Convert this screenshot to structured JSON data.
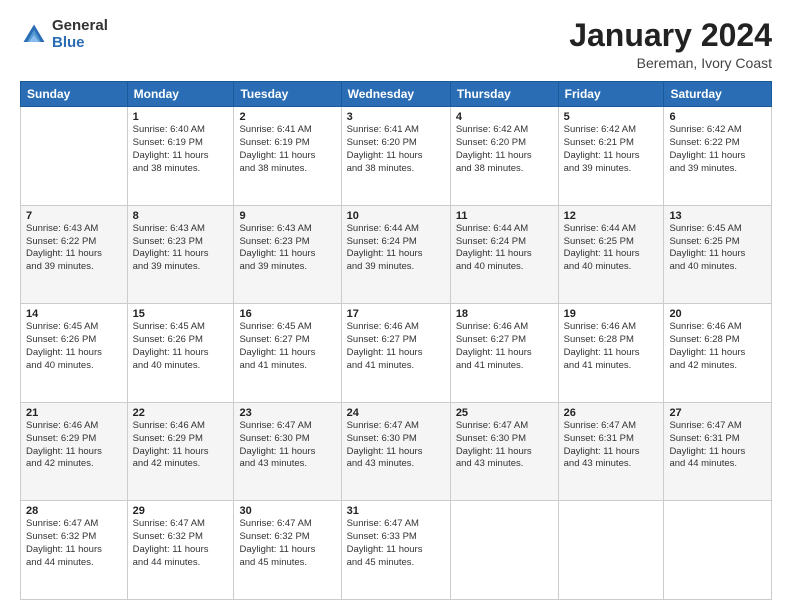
{
  "header": {
    "logo": {
      "general": "General",
      "blue": "Blue"
    },
    "title": "January 2024",
    "location": "Bereman, Ivory Coast"
  },
  "days_of_week": [
    "Sunday",
    "Monday",
    "Tuesday",
    "Wednesday",
    "Thursday",
    "Friday",
    "Saturday"
  ],
  "weeks": [
    [
      {
        "day": "",
        "sunrise": "",
        "sunset": "",
        "daylight": ""
      },
      {
        "day": "1",
        "sunrise": "Sunrise: 6:40 AM",
        "sunset": "Sunset: 6:19 PM",
        "daylight": "Daylight: 11 hours and 38 minutes."
      },
      {
        "day": "2",
        "sunrise": "Sunrise: 6:41 AM",
        "sunset": "Sunset: 6:19 PM",
        "daylight": "Daylight: 11 hours and 38 minutes."
      },
      {
        "day": "3",
        "sunrise": "Sunrise: 6:41 AM",
        "sunset": "Sunset: 6:20 PM",
        "daylight": "Daylight: 11 hours and 38 minutes."
      },
      {
        "day": "4",
        "sunrise": "Sunrise: 6:42 AM",
        "sunset": "Sunset: 6:20 PM",
        "daylight": "Daylight: 11 hours and 38 minutes."
      },
      {
        "day": "5",
        "sunrise": "Sunrise: 6:42 AM",
        "sunset": "Sunset: 6:21 PM",
        "daylight": "Daylight: 11 hours and 39 minutes."
      },
      {
        "day": "6",
        "sunrise": "Sunrise: 6:42 AM",
        "sunset": "Sunset: 6:22 PM",
        "daylight": "Daylight: 11 hours and 39 minutes."
      }
    ],
    [
      {
        "day": "7",
        "sunrise": "Sunrise: 6:43 AM",
        "sunset": "Sunset: 6:22 PM",
        "daylight": "Daylight: 11 hours and 39 minutes."
      },
      {
        "day": "8",
        "sunrise": "Sunrise: 6:43 AM",
        "sunset": "Sunset: 6:23 PM",
        "daylight": "Daylight: 11 hours and 39 minutes."
      },
      {
        "day": "9",
        "sunrise": "Sunrise: 6:43 AM",
        "sunset": "Sunset: 6:23 PM",
        "daylight": "Daylight: 11 hours and 39 minutes."
      },
      {
        "day": "10",
        "sunrise": "Sunrise: 6:44 AM",
        "sunset": "Sunset: 6:24 PM",
        "daylight": "Daylight: 11 hours and 39 minutes."
      },
      {
        "day": "11",
        "sunrise": "Sunrise: 6:44 AM",
        "sunset": "Sunset: 6:24 PM",
        "daylight": "Daylight: 11 hours and 40 minutes."
      },
      {
        "day": "12",
        "sunrise": "Sunrise: 6:44 AM",
        "sunset": "Sunset: 6:25 PM",
        "daylight": "Daylight: 11 hours and 40 minutes."
      },
      {
        "day": "13",
        "sunrise": "Sunrise: 6:45 AM",
        "sunset": "Sunset: 6:25 PM",
        "daylight": "Daylight: 11 hours and 40 minutes."
      }
    ],
    [
      {
        "day": "14",
        "sunrise": "Sunrise: 6:45 AM",
        "sunset": "Sunset: 6:26 PM",
        "daylight": "Daylight: 11 hours and 40 minutes."
      },
      {
        "day": "15",
        "sunrise": "Sunrise: 6:45 AM",
        "sunset": "Sunset: 6:26 PM",
        "daylight": "Daylight: 11 hours and 40 minutes."
      },
      {
        "day": "16",
        "sunrise": "Sunrise: 6:45 AM",
        "sunset": "Sunset: 6:27 PM",
        "daylight": "Daylight: 11 hours and 41 minutes."
      },
      {
        "day": "17",
        "sunrise": "Sunrise: 6:46 AM",
        "sunset": "Sunset: 6:27 PM",
        "daylight": "Daylight: 11 hours and 41 minutes."
      },
      {
        "day": "18",
        "sunrise": "Sunrise: 6:46 AM",
        "sunset": "Sunset: 6:27 PM",
        "daylight": "Daylight: 11 hours and 41 minutes."
      },
      {
        "day": "19",
        "sunrise": "Sunrise: 6:46 AM",
        "sunset": "Sunset: 6:28 PM",
        "daylight": "Daylight: 11 hours and 41 minutes."
      },
      {
        "day": "20",
        "sunrise": "Sunrise: 6:46 AM",
        "sunset": "Sunset: 6:28 PM",
        "daylight": "Daylight: 11 hours and 42 minutes."
      }
    ],
    [
      {
        "day": "21",
        "sunrise": "Sunrise: 6:46 AM",
        "sunset": "Sunset: 6:29 PM",
        "daylight": "Daylight: 11 hours and 42 minutes."
      },
      {
        "day": "22",
        "sunrise": "Sunrise: 6:46 AM",
        "sunset": "Sunset: 6:29 PM",
        "daylight": "Daylight: 11 hours and 42 minutes."
      },
      {
        "day": "23",
        "sunrise": "Sunrise: 6:47 AM",
        "sunset": "Sunset: 6:30 PM",
        "daylight": "Daylight: 11 hours and 43 minutes."
      },
      {
        "day": "24",
        "sunrise": "Sunrise: 6:47 AM",
        "sunset": "Sunset: 6:30 PM",
        "daylight": "Daylight: 11 hours and 43 minutes."
      },
      {
        "day": "25",
        "sunrise": "Sunrise: 6:47 AM",
        "sunset": "Sunset: 6:30 PM",
        "daylight": "Daylight: 11 hours and 43 minutes."
      },
      {
        "day": "26",
        "sunrise": "Sunrise: 6:47 AM",
        "sunset": "Sunset: 6:31 PM",
        "daylight": "Daylight: 11 hours and 43 minutes."
      },
      {
        "day": "27",
        "sunrise": "Sunrise: 6:47 AM",
        "sunset": "Sunset: 6:31 PM",
        "daylight": "Daylight: 11 hours and 44 minutes."
      }
    ],
    [
      {
        "day": "28",
        "sunrise": "Sunrise: 6:47 AM",
        "sunset": "Sunset: 6:32 PM",
        "daylight": "Daylight: 11 hours and 44 minutes."
      },
      {
        "day": "29",
        "sunrise": "Sunrise: 6:47 AM",
        "sunset": "Sunset: 6:32 PM",
        "daylight": "Daylight: 11 hours and 44 minutes."
      },
      {
        "day": "30",
        "sunrise": "Sunrise: 6:47 AM",
        "sunset": "Sunset: 6:32 PM",
        "daylight": "Daylight: 11 hours and 45 minutes."
      },
      {
        "day": "31",
        "sunrise": "Sunrise: 6:47 AM",
        "sunset": "Sunset: 6:33 PM",
        "daylight": "Daylight: 11 hours and 45 minutes."
      },
      {
        "day": "",
        "sunrise": "",
        "sunset": "",
        "daylight": ""
      },
      {
        "day": "",
        "sunrise": "",
        "sunset": "",
        "daylight": ""
      },
      {
        "day": "",
        "sunrise": "",
        "sunset": "",
        "daylight": ""
      }
    ]
  ]
}
